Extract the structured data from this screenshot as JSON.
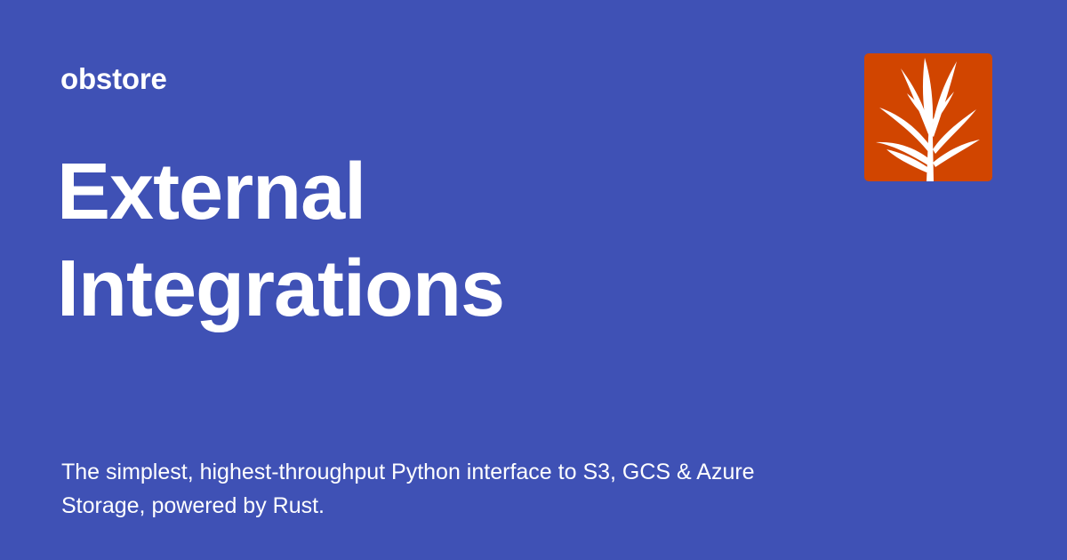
{
  "site": {
    "name": "obstore"
  },
  "page": {
    "title_lines": [
      "External",
      "Integrations"
    ],
    "description": "The simplest, highest-throughput Python interface to S3, GCS & Azure Storage, powered by Rust."
  },
  "logo": {
    "icon": "plant-icon",
    "background_color": "#d14500",
    "foreground_color": "#ffffff"
  },
  "theme": {
    "background_color": "#3f51b5",
    "text_color": "#ffffff"
  }
}
